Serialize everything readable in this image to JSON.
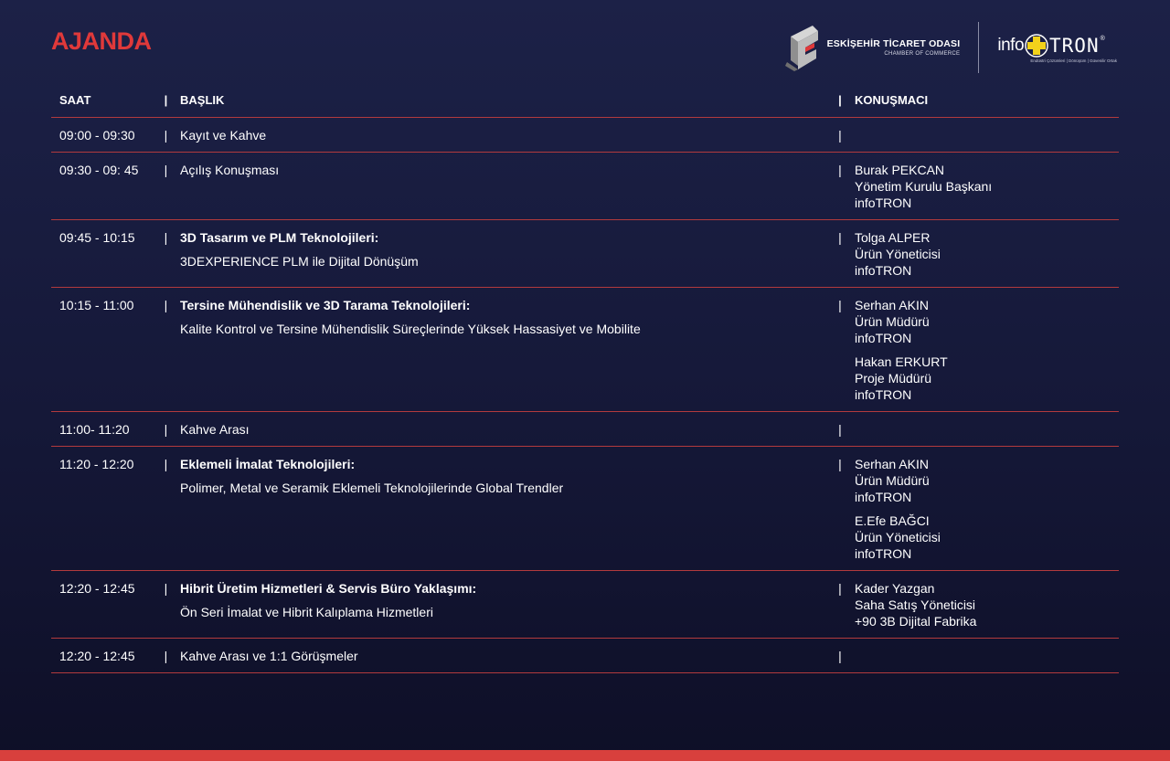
{
  "page": {
    "title": "AJANDA",
    "accent": "#e0393a"
  },
  "logos": {
    "eto_name": "ESKİŞEHİR TİCARET ODASI",
    "eto_sub": "CHAMBER OF COMMERCE",
    "infotron_info": "info",
    "infotron_tron": "TRON",
    "infotron_reg": "®",
    "infotron_tag": "Endüstri Çözümleri | Dönüşüm | Güvenilir Ortak"
  },
  "table": {
    "headers": {
      "time": "SAAT",
      "title": "BAŞLIK",
      "speaker": "KONUŞMACI"
    },
    "separator": "|",
    "rows": [
      {
        "time": "09:00 - 09:30",
        "title": "Kayıt ve Kahve",
        "title_bold": false,
        "subtitle": "",
        "speakers": []
      },
      {
        "time": "09:30 - 09: 45",
        "title": "Açılış Konuşması",
        "title_bold": false,
        "subtitle": "",
        "speakers": [
          {
            "name": "Burak PEKCAN",
            "role": "Yönetim Kurulu Başkanı",
            "org": "infoTRON"
          }
        ]
      },
      {
        "time": "09:45 - 10:15",
        "title": "3D Tasarım ve PLM Teknolojileri:",
        "title_bold": true,
        "subtitle": "3DEXPERIENCE PLM ile Dijital Dönüşüm",
        "speakers": [
          {
            "name": "Tolga ALPER",
            "role": "Ürün Yöneticisi",
            "org": "infoTRON"
          }
        ]
      },
      {
        "time": "10:15 - 11:00",
        "title": "Tersine Mühendislik ve 3D Tarama Teknolojileri:",
        "title_bold": true,
        "subtitle": "Kalite Kontrol  ve Tersine Mühendislik Süreçlerinde Yüksek Hassasiyet ve Mobilite",
        "speakers": [
          {
            "name": "Serhan AKIN",
            "role": "Ürün Müdürü",
            "org": "infoTRON"
          },
          {
            "name": "Hakan ERKURT",
            "role": "Proje Müdürü",
            "org": "infoTRON"
          }
        ]
      },
      {
        "time": "11:00- 11:20",
        "title": "Kahve Arası",
        "title_bold": false,
        "subtitle": "",
        "speakers": []
      },
      {
        "time": "11:20 - 12:20",
        "title": "Eklemeli İmalat Teknolojileri:",
        "title_bold": true,
        "subtitle": "Polimer, Metal ve Seramik Eklemeli Teknolojilerinde Global Trendler",
        "speakers": [
          {
            "name": "Serhan AKIN",
            "role": "Ürün Müdürü",
            "org": "infoTRON"
          },
          {
            "name": "E.Efe BAĞCI",
            "role": "Ürün Yöneticisi",
            "org": "infoTRON"
          }
        ]
      },
      {
        "time": "12:20 - 12:45",
        "title": "Hibrit Üretim Hizmetleri & Servis Büro Yaklaşımı:",
        "title_bold": true,
        "subtitle": "Ön Seri İmalat ve Hibrit Kalıplama Hizmetleri",
        "speakers": [
          {
            "name": "Kader Yazgan",
            "role": "Saha Satış Yöneticisi",
            "org": "+90 3B Dijital Fabrika"
          }
        ]
      },
      {
        "time": "12:20 - 12:45",
        "title": "Kahve Arası ve 1:1 Görüşmeler",
        "title_bold": false,
        "subtitle": "",
        "speakers": []
      }
    ]
  }
}
